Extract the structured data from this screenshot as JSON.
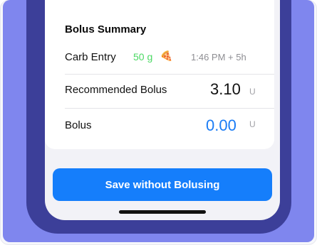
{
  "bolus_summary": {
    "title": "Bolus Summary",
    "carb_entry": {
      "label": "Carb Entry",
      "amount": "50 g",
      "food_icon": "pizza-icon",
      "time": "1:46 PM + 5h"
    },
    "recommended": {
      "label": "Recommended Bolus",
      "value": "3.10",
      "unit": "U"
    },
    "bolus": {
      "label": "Bolus",
      "value": "0.00",
      "unit": "U"
    }
  },
  "actions": {
    "save_without_bolusing": "Save without Bolusing"
  },
  "colors": {
    "backdrop": "#7f86ee",
    "phone_frame": "#3c3f99",
    "accent_blue": "#157efb",
    "carb_green": "#4cd964"
  }
}
